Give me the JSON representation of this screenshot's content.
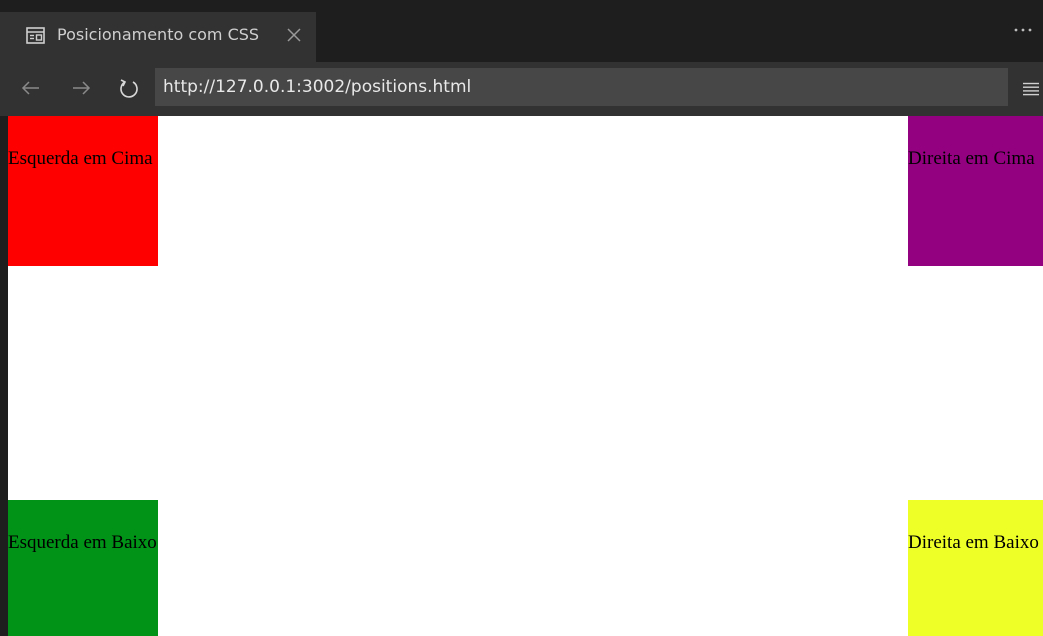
{
  "tab": {
    "title": "Posicionamento com CSS",
    "icon": "reader-view-icon",
    "close_icon": "close-icon"
  },
  "window": {
    "more_icon": "more-options-icon"
  },
  "navigation": {
    "back_icon": "arrow-left-icon",
    "forward_icon": "arrow-right-icon",
    "reload_icon": "reload-icon",
    "url": "http://127.0.0.1:3002/positions.html",
    "menu_icon": "hamburger-menu-icon"
  },
  "page": {
    "boxes": [
      {
        "label": "Esquerda em Cima",
        "color": "#ff0000"
      },
      {
        "label": "Direita em Cima",
        "color": "#930080"
      },
      {
        "label": "Esquerda em Baixo",
        "color": "#009318"
      },
      {
        "label": "Direita em Baixo",
        "color": "#eeff28"
      }
    ]
  },
  "colors": {
    "chrome_dark": "#1e1e1e",
    "chrome_mid": "#323232",
    "address_bg": "#474747",
    "page_bg": "#ffffff"
  }
}
